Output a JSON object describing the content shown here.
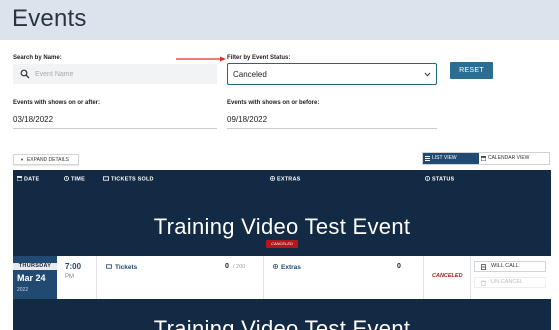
{
  "page": {
    "title": "Events"
  },
  "filters": {
    "search_label": "Search by Name:",
    "search_placeholder": "Event Name",
    "status_label": "Filter by Event Status:",
    "status_value": "Canceled",
    "reset_label": "RESET",
    "after_label": "Events with shows on or after:",
    "after_value": "03/18/2022",
    "before_label": "Events with shows on or before:",
    "before_value": "09/18/2022"
  },
  "controls": {
    "expand_label": "EXPAND DETAILS",
    "list_view_label": "LIST VIEW",
    "calendar_view_label": "CALENDAR VIEW"
  },
  "table": {
    "headers": {
      "date": "DATE",
      "time": "TIME",
      "tickets_sold": "TICKETS SOLD",
      "extras": "EXTRAS",
      "status": "STATUS"
    },
    "events": [
      {
        "title": "Training Video Test Event",
        "badge": "CANCELED",
        "shows": [
          {
            "day_of_week": "THURSDAY",
            "month_day": "Mar 24",
            "year": "2022",
            "time": "7:00",
            "ampm": "PM",
            "tickets_label": "Tickets",
            "tickets_sold": "0",
            "tickets_capacity": "/ 200",
            "extras_label": "Extras",
            "extras_count": "0",
            "status": "CANCELED",
            "will_call_label": "WILL CALL",
            "un_cancel_label": "UN-CANCEL"
          }
        ]
      },
      {
        "title": "Training Video Test Event"
      }
    ]
  },
  "colors": {
    "header_bg": "#dde3ec",
    "table_bg": "#122a44",
    "accent": "#214a73",
    "reset_bg": "#2c6e93",
    "cancel_red": "#b3161b",
    "annotation_arrow": "#d9342b"
  }
}
